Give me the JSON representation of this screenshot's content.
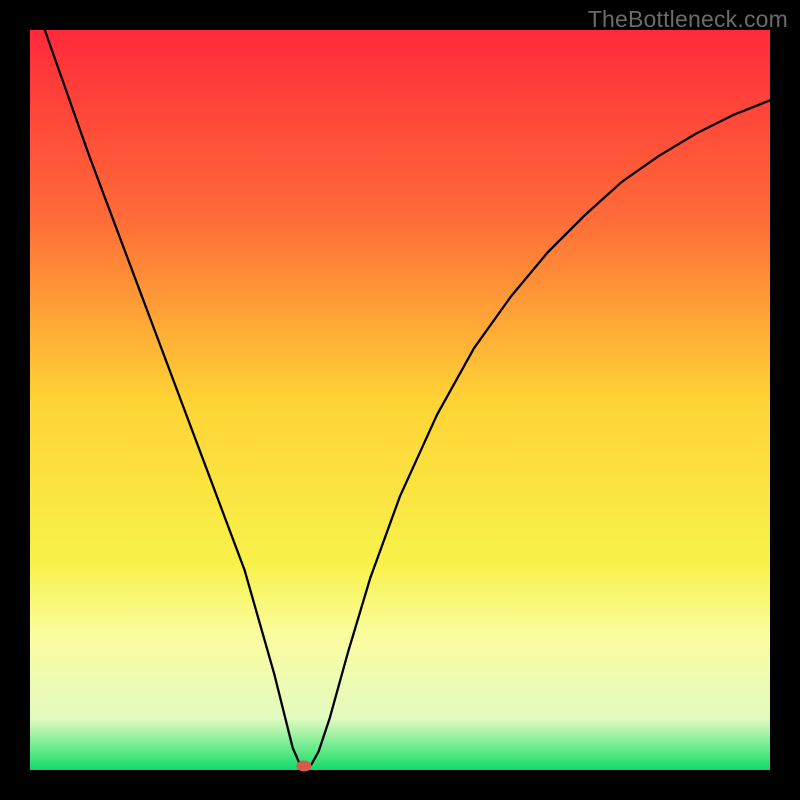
{
  "watermark": {
    "text": "TheBottleneck.com"
  },
  "chart_data": {
    "type": "line",
    "title": "",
    "xlabel": "",
    "ylabel": "",
    "xlim": [
      0,
      100
    ],
    "ylim": [
      0,
      100
    ],
    "gradient_stops": [
      {
        "pos": 0.0,
        "color": "#ff2a3a"
      },
      {
        "pos": 0.25,
        "color": "#ff6a38"
      },
      {
        "pos": 0.5,
        "color": "#ffd335"
      },
      {
        "pos": 0.72,
        "color": "#f7f24a"
      },
      {
        "pos": 0.82,
        "color": "#fbfca0"
      },
      {
        "pos": 0.93,
        "color": "#e3fbc0"
      },
      {
        "pos": 0.985,
        "color": "#3fe47a"
      },
      {
        "pos": 1.0,
        "color": "#12d86b"
      }
    ],
    "series": [
      {
        "name": "bottleneck-curve",
        "x": [
          2,
          5,
          8,
          11,
          14,
          17,
          20,
          23,
          26,
          29,
          31,
          33,
          34.5,
          35.5,
          36.5,
          37,
          38,
          39,
          40.5,
          43,
          46,
          50,
          55,
          60,
          65,
          70,
          75,
          80,
          85,
          90,
          95,
          100
        ],
        "y": [
          100,
          91.5,
          83,
          75,
          67,
          59,
          51,
          43,
          35,
          27,
          20,
          13,
          7,
          3,
          0.7,
          0.2,
          0.7,
          2.5,
          7,
          16,
          26,
          37,
          48,
          57,
          64,
          70,
          75,
          79.5,
          83,
          86,
          88.5,
          90.5
        ]
      }
    ],
    "marker": {
      "x": 37,
      "y": 0.5
    }
  }
}
